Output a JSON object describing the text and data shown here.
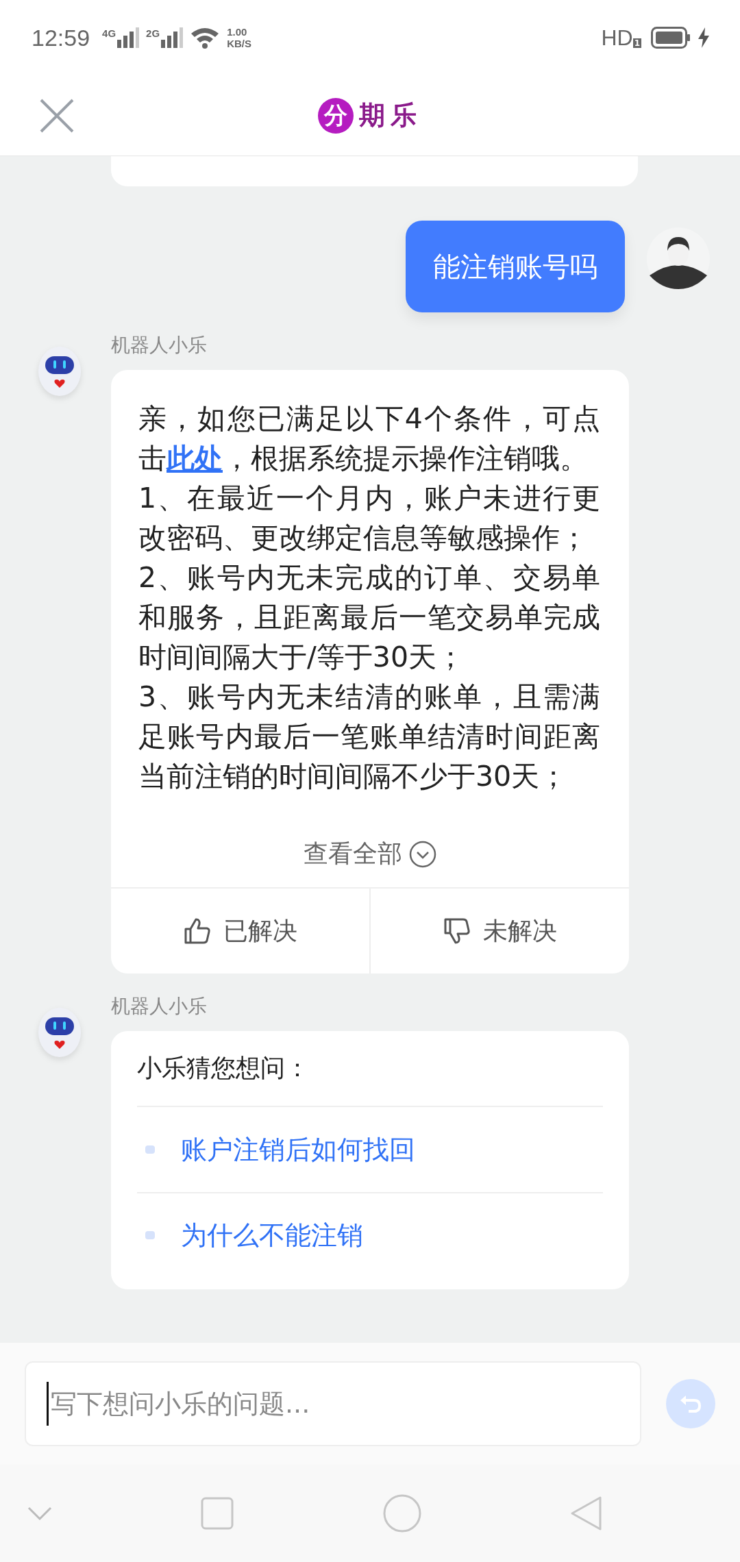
{
  "status_bar": {
    "time": "12:59",
    "sim1": "4G",
    "sim2": "2G",
    "speed_value": "1.00",
    "speed_unit": "KB/S",
    "hd": "HD",
    "hd_sub": "1"
  },
  "header": {
    "logo_badge": "分",
    "logo_text": "期乐"
  },
  "messages": [
    {
      "kind": "partial"
    },
    {
      "kind": "user",
      "text": "能注销账号吗"
    },
    {
      "kind": "answer",
      "sender": "机器人小乐",
      "intro_before": "亲，如您已满足以下4个条件，可点击",
      "link": "此处",
      "intro_after": "，根据系统提示操作注销哦。",
      "items": [
        "1、在最近一个月内，账户未进行更改密码、更改绑定信息等敏感操作；",
        "2、账号内无未完成的订单、交易单和服务，且距离最后一笔交易单完成时间间隔大于/等于30天；",
        "3、账号内无未结清的账单，且需满足账号内最后一笔账单结清时间距离当前注销的时间间隔不少于30天；"
      ],
      "expand": "查看全部",
      "feedback": [
        {
          "kind": "up",
          "label": "已解决"
        },
        {
          "kind": "down",
          "label": "未解决"
        }
      ]
    },
    {
      "kind": "suggest",
      "sender": "机器人小乐",
      "title": "小乐猜您想问：",
      "questions": [
        "账户注销后如何找回",
        "为什么不能注销"
      ]
    }
  ],
  "input": {
    "placeholder": "写下想问小乐的问题..."
  }
}
